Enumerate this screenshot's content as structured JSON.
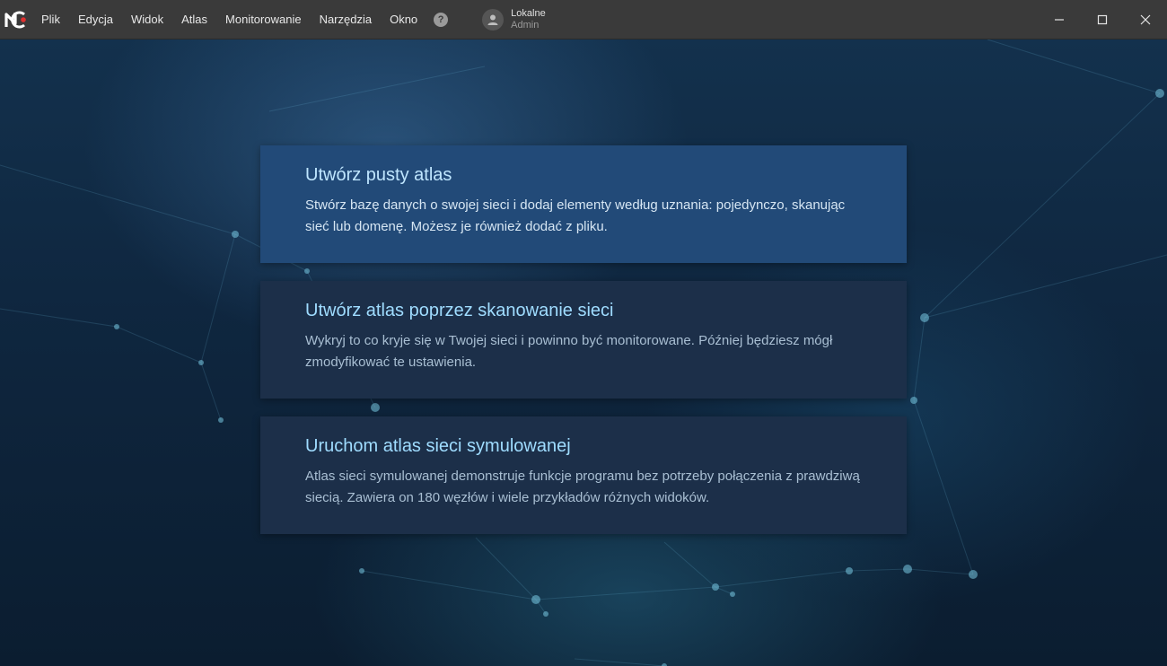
{
  "menu": [
    "Plik",
    "Edycja",
    "Widok",
    "Atlas",
    "Monitorowanie",
    "Narzędzia",
    "Okno"
  ],
  "help_label": "?",
  "user": {
    "name": "Lokalne",
    "role": "Admin"
  },
  "window_controls": [
    "minimize-icon",
    "maximize-icon",
    "close-icon"
  ],
  "cards": [
    {
      "title": "Utwórz pusty atlas",
      "description": "Stwórz bazę danych o swojej sieci i dodaj elementy według uznania: pojedynczo, skanując sieć lub domenę. Możesz je również dodać z pliku."
    },
    {
      "title": "Utwórz atlas poprzez skanowanie sieci",
      "description": "Wykryj to co kryje się w Twojej sieci i powinno być monitorowane. Później będziesz mógł zmodyfikować te ustawienia."
    },
    {
      "title": "Uruchom atlas sieci symulowanej",
      "description": "Atlas sieci symulowanej demonstruje funkcje programu bez potrzeby połączenia z prawdziwą siecią. Zawiera on 180 węzłów i wiele przykładów różnych widoków."
    }
  ],
  "colors": {
    "titlebar": "#3a3a3a",
    "card_active": "#224a78",
    "card_normal": "#1c2f49",
    "card_title": "#9fdcff",
    "logo_accent": "#e0302f"
  }
}
